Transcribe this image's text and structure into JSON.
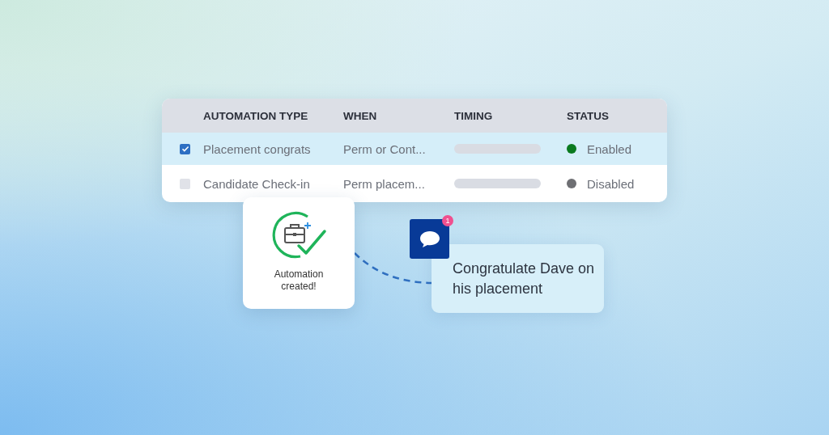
{
  "table": {
    "columns": [
      "AUTOMATION TYPE",
      "WHEN",
      "TIMING",
      "STATUS"
    ],
    "rows": [
      {
        "checked": true,
        "selected": true,
        "type": "Placement congrats",
        "when": "Perm or Cont...",
        "status": "Enabled",
        "color": "#0a7a1f"
      },
      {
        "checked": false,
        "selected": false,
        "type": "Candidate Check-in",
        "when": "Perm placem...",
        "status": "Disabled",
        "color": "#6e6f73"
      }
    ]
  },
  "toast": {
    "message": "Automation created!"
  },
  "chat": {
    "badge": "1",
    "message": "Congratulate Dave on his placement"
  }
}
